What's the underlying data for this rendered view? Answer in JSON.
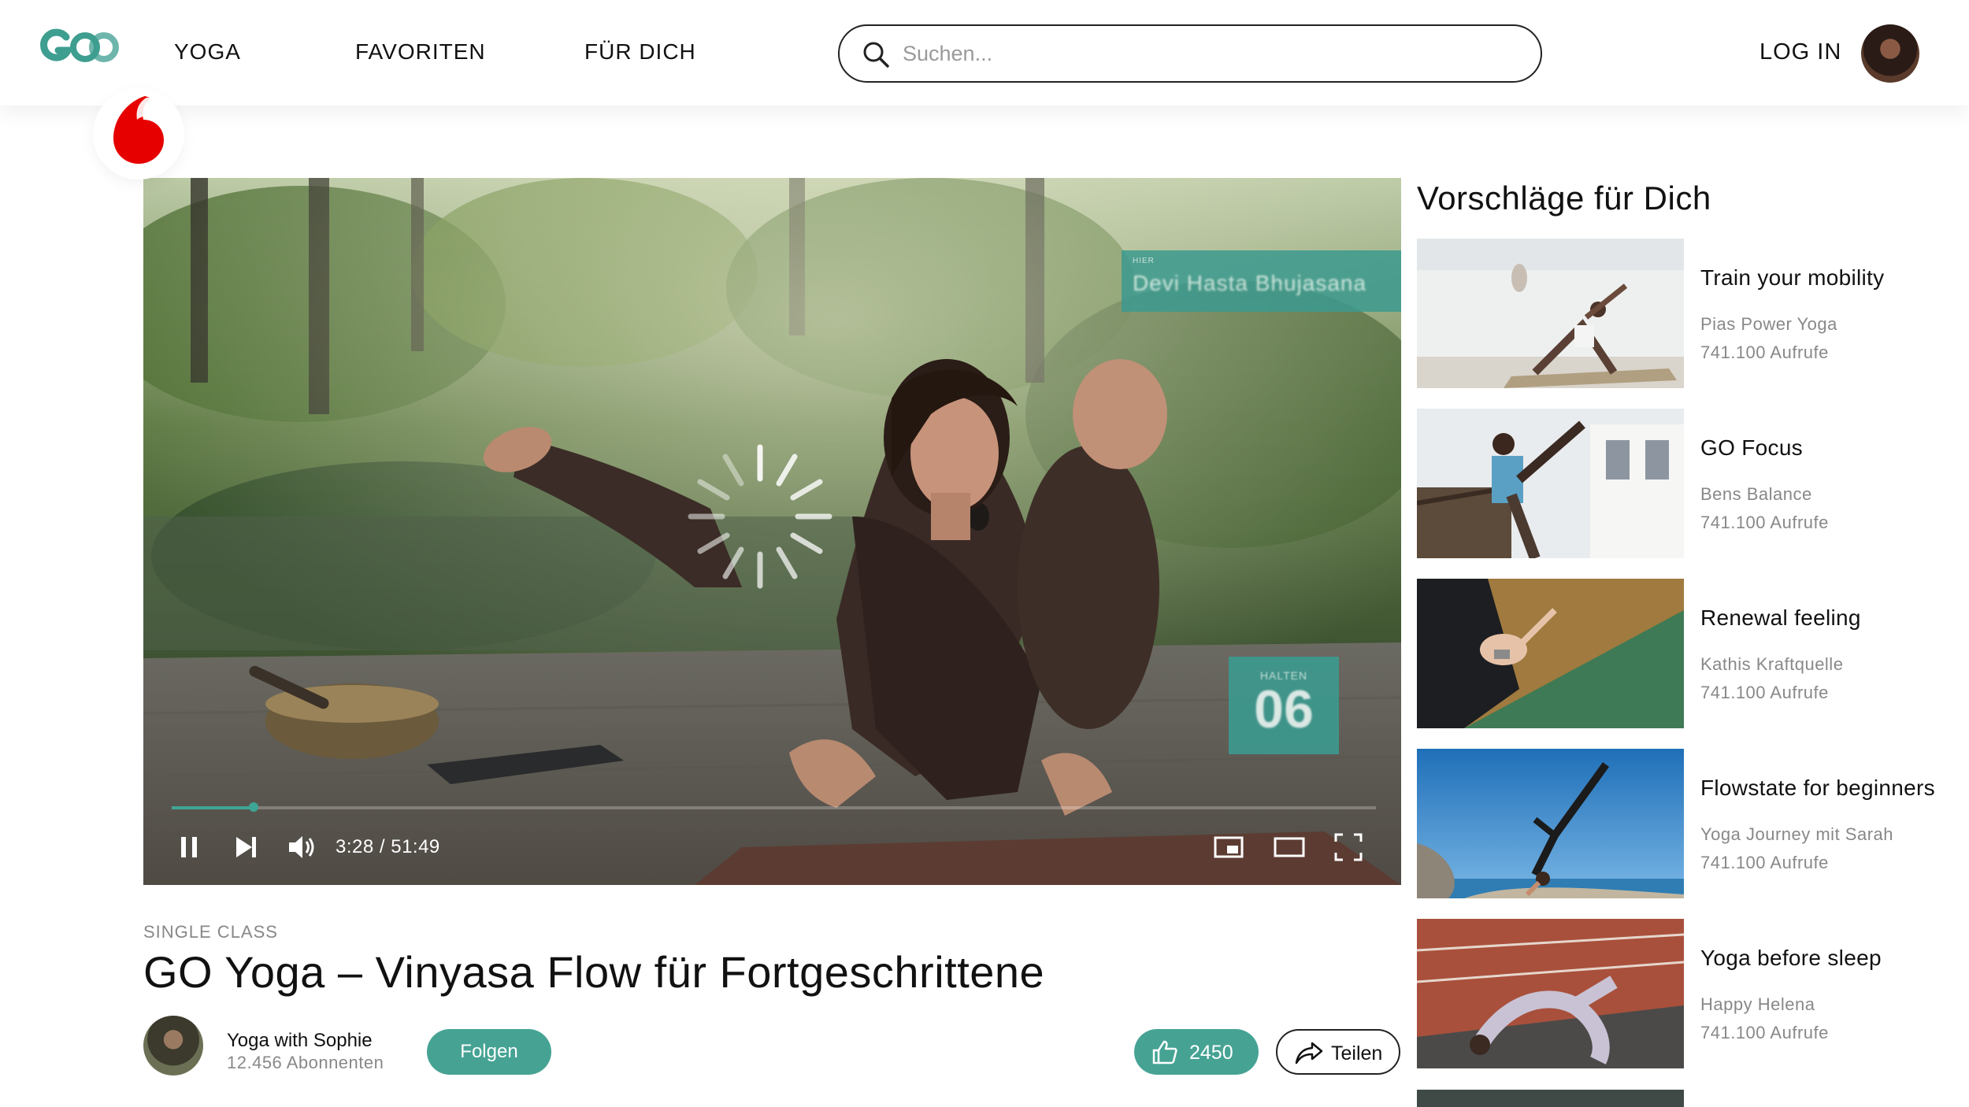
{
  "header": {
    "logo_label": "GO",
    "nav": [
      {
        "label": "YOGA"
      },
      {
        "label": "FAVORITEN"
      },
      {
        "label": "FÜR DICH"
      }
    ],
    "search": {
      "placeholder": "Suchen...",
      "value": ""
    },
    "login_label": "LOG IN",
    "icons": {
      "search": "search-icon",
      "avatar": "user-avatar",
      "brand": "vodafone-logo"
    }
  },
  "colors": {
    "accent": "#46a394",
    "brand_red": "#e60000",
    "text_primary": "#111111",
    "text_secondary": "#888888"
  },
  "video": {
    "overlay_name": "Devi Hasta Bhujasana",
    "overlay_label": "HIER",
    "counter_label": "HALTEN",
    "counter_value": "06",
    "time_display": "3:28 / 51:49",
    "progress_fraction": 0.068,
    "state": "loading",
    "controls": [
      "pause-icon",
      "skip-next-icon",
      "volume-icon",
      "miniplayer-icon",
      "theater-mode-icon",
      "fullscreen-icon"
    ]
  },
  "info": {
    "category": "SINGLE CLASS",
    "title": "GO Yoga – Vinyasa Flow für Fortgeschrittene",
    "channel": {
      "name": "Yoga with Sophie",
      "subscribers": "12.456 Abonnenten"
    },
    "follow_label": "Folgen",
    "like_count": "2450",
    "share_label": "Teilen"
  },
  "sidebar": {
    "title": "Vorschläge für Dich",
    "items": [
      {
        "title": "Train your mobility",
        "channel": "Pias Power Yoga",
        "views": "741.100 Aufrufe"
      },
      {
        "title": "GO Focus",
        "channel": "Bens Balance",
        "views": "741.100 Aufrufe"
      },
      {
        "title": "Renewal feeling",
        "channel": "Kathis Kraftquelle",
        "views": "741.100 Aufrufe"
      },
      {
        "title": "Flowstate for beginners",
        "channel": "Yoga Journey mit Sarah",
        "views": "741.100 Aufrufe"
      },
      {
        "title": "Yoga before sleep",
        "channel": "Happy Helena",
        "views": "741.100 Aufrufe"
      }
    ]
  }
}
